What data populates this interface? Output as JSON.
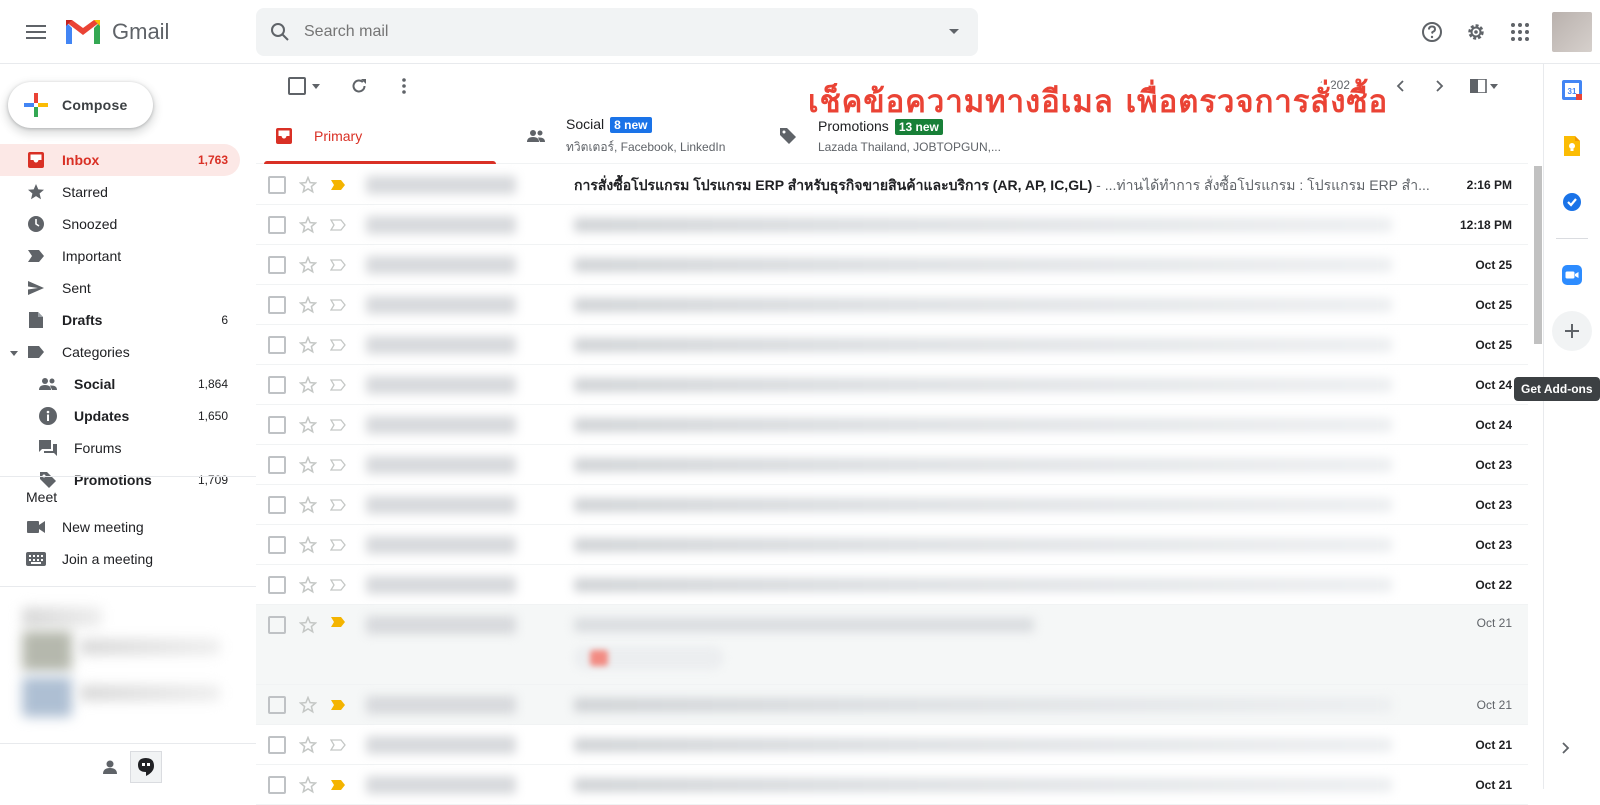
{
  "app": {
    "name": "Gmail"
  },
  "search": {
    "placeholder": "Search mail"
  },
  "compose": {
    "label": "Compose"
  },
  "nav": {
    "inbox": {
      "label": "Inbox",
      "count": "1,763"
    },
    "starred": {
      "label": "Starred"
    },
    "snoozed": {
      "label": "Snoozed"
    },
    "important": {
      "label": "Important"
    },
    "sent": {
      "label": "Sent"
    },
    "drafts": {
      "label": "Drafts",
      "count": "6"
    },
    "categories": {
      "label": "Categories"
    },
    "social": {
      "label": "Social",
      "count": "1,864"
    },
    "updates": {
      "label": "Updates",
      "count": "1,650"
    },
    "forums": {
      "label": "Forums"
    },
    "promotions": {
      "label": "Promotions",
      "count": "1,709"
    }
  },
  "meet": {
    "title": "Meet",
    "new_meeting": "New meeting",
    "join_meeting": "Join a meeting"
  },
  "toolbar": {
    "page_info": "2,202"
  },
  "banner": "เช็คข้อความทางอีเมล เพื่อตรวจการสั่งซื้อ",
  "tabs": {
    "primary": {
      "label": "Primary"
    },
    "social": {
      "label": "Social",
      "badge": "8 new",
      "sub": "ทวิตเตอร์, Facebook, LinkedIn"
    },
    "promotions": {
      "label": "Promotions",
      "badge": "13 new",
      "sub": "Lazada Thailand, JOBTOPGUN,..."
    }
  },
  "emails": [
    {
      "subject": "การสั่งซื้อโปรแกรม โปรแกรม ERP สำหรับธุรกิจขายสินค้าและบริการ (AR, AP, IC,GL)",
      "snippet": " - ...ท่านได้ทำการ สั่งซื้อโปรแกรม : โปรแกรม ERP สำ...",
      "date": "2:16 PM"
    },
    {
      "date": "12:18 PM"
    },
    {
      "date": "Oct 25"
    },
    {
      "date": "Oct 25"
    },
    {
      "date": "Oct 25"
    },
    {
      "date": "Oct 24"
    },
    {
      "date": "Oct 24"
    },
    {
      "date": "Oct 23"
    },
    {
      "date": "Oct 23"
    },
    {
      "date": "Oct 23"
    },
    {
      "date": "Oct 22"
    },
    {
      "date": "Oct 21"
    },
    {
      "date": "Oct 21"
    },
    {
      "date": "Oct 21"
    },
    {
      "date": "Oct 21"
    }
  ],
  "right_panel": {
    "tooltip": "Get Add-ons"
  },
  "colors": {
    "red": "#d93025",
    "social_badge": "#1a73e8",
    "promo_badge": "#188038",
    "important_marker": "#f4b400"
  }
}
